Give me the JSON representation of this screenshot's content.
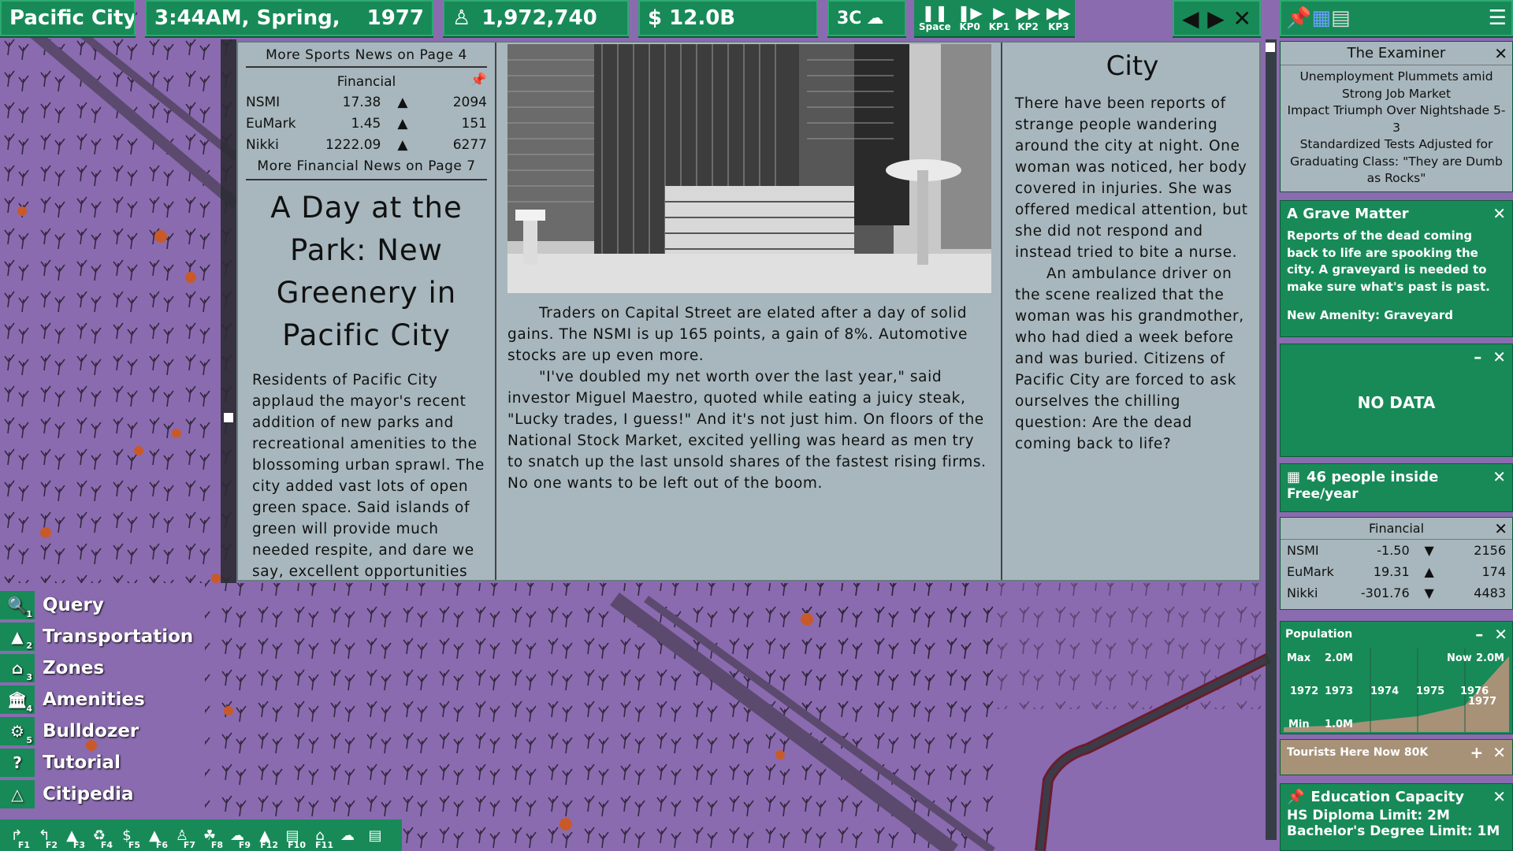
{
  "topbar": {
    "city_name": "Pacific City",
    "datetime": "3:44AM, Spring,",
    "year": "1977",
    "population": "1,972,740",
    "money": "$ 12.0B",
    "temperature": "3C",
    "speed_buttons": [
      {
        "label": "Space",
        "icon": "pause-icon"
      },
      {
        "label": "KP0",
        "icon": "step-icon"
      },
      {
        "label": "KP1",
        "icon": "play-icon"
      },
      {
        "label": "KP2",
        "icon": "fast-icon"
      },
      {
        "label": "KP3",
        "icon": "fastest-icon"
      }
    ]
  },
  "newspaper": {
    "sports_more": "More Sports News on Page 4",
    "financial_title": "Financial",
    "financial_rows": [
      {
        "name": "NSMI",
        "value": "17.38",
        "dir": "up",
        "vol": "2094"
      },
      {
        "name": "EuMark",
        "value": "1.45",
        "dir": "up",
        "vol": "151"
      },
      {
        "name": "Nikki",
        "value": "1222.09",
        "dir": "up",
        "vol": "6277"
      }
    ],
    "financial_more": "More Financial News on Page 7",
    "headline": "A Day at the Park: New Greenery in Pacific City",
    "park_story": "Residents of Pacific City applaud the mayor's recent addition of new parks and recreational amenities to the blossoming urban sprawl. The city added vast lots of open green space. Said islands of green will provide much needed respite, and dare we say, excellent opportunities to",
    "traders_story": "Traders on Capital Street are elated after a day of solid gains. The NSMI is up 165 points, a gain of 8%. Automotive stocks are up even more.",
    "traders_story2": "\"I've doubled my net worth over the last year,\" said investor Miguel Maestro, quoted while eating a juicy steak, \"Lucky trades, I guess!\" And it's not just him. On floors of the National Stock Market, excited yelling was heard as men try to snatch up the last unsold shares of the fastest rising firms. No one wants to be left out of the boom.",
    "city_section": "City",
    "city_story": "There have been reports of strange people wandering around the city at night. One woman was noticed, her body covered in injuries. She was offered medical attention, but she did not respond and instead tried to bite a nurse.",
    "city_story2": "An ambulance driver on the scene realized that the woman was his grandmother, who had died a week before and was buried. Citizens of Pacific City are forced to ask ourselves the chilling question: Are the dead coming back to life?"
  },
  "left_menu": [
    {
      "label": "Query",
      "key": "1",
      "icon": "magnifier-icon"
    },
    {
      "label": "Transportation",
      "key": "2",
      "icon": "road-icon"
    },
    {
      "label": "Zones",
      "key": "3",
      "icon": "house-icon"
    },
    {
      "label": "Amenities",
      "key": "4",
      "icon": "building-icon"
    },
    {
      "label": "Bulldozer",
      "key": "5",
      "icon": "bulldozer-icon"
    },
    {
      "label": "Tutorial",
      "key": "",
      "icon": "question-icon"
    },
    {
      "label": "Citipedia",
      "key": "",
      "icon": "book-icon"
    }
  ],
  "bottom_tools": [
    "F1",
    "F2",
    "F3",
    "F4",
    "F5",
    "F6",
    "F7",
    "F8",
    "F9",
    "F12",
    "F10",
    "F11",
    "",
    ""
  ],
  "right": {
    "examiner_title": "The Examiner",
    "examiner_headlines": "Unemployment Plummets amid Strong Job Market\nImpact Triumph Over Nightshade 5-3\nStandardized Tests Adjusted for Graduating Class: \"They are Dumb as Rocks\"",
    "grave_title": "A Grave Matter",
    "grave_text": "Reports of the dead coming back to life are spooking the city. A graveyard is needed to make sure what's past is past.",
    "grave_amenity": "New Amenity: Graveyard",
    "nodata": "NO DATA",
    "inside_title": "46 people inside",
    "inside_sub": "Free/year",
    "fin_title": "Financial",
    "fin_rows": [
      {
        "name": "NSMI",
        "value": "-1.50",
        "dir": "down",
        "vol": "2156"
      },
      {
        "name": "EuMark",
        "value": "19.31",
        "dir": "up",
        "vol": "174"
      },
      {
        "name": "Nikki",
        "value": "-301.76",
        "dir": "down",
        "vol": "4483"
      }
    ],
    "pop_title": "Population",
    "pop_max_label": "Max",
    "pop_max": "2.0M",
    "pop_now_label": "Now",
    "pop_now": "2.0M",
    "pop_min_label": "Min",
    "pop_min": "1.0M",
    "pop_years": [
      "1972",
      "1973",
      "1974",
      "1975",
      "1976"
    ],
    "pop_year_last": "1977",
    "tourists": "Tourists Here Now 80K",
    "edu_title": "Education Capacity",
    "edu_line1": "HS Diploma Limit: 2M",
    "edu_line2": "Bachelor's Degree Limit: 1M"
  },
  "colors": {
    "ui_green": "#178a58",
    "paper": "#a7b7bd",
    "map": "#8a6bb0"
  }
}
